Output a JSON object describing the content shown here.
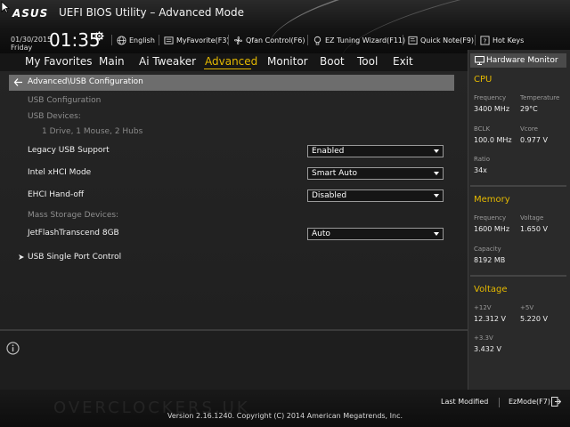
{
  "header": {
    "logo": "ASUS",
    "app_title": "UEFI BIOS Utility – Advanced Mode",
    "date": "01/30/2015",
    "day": "Friday",
    "time": "01:35",
    "buttons": {
      "language": "English",
      "myfavorite": "MyFavorite(F3)",
      "qfan": "Qfan Control(F6)",
      "ez_tuning": "EZ Tuning Wizard(F11)",
      "quick_note": "Quick Note(F9)",
      "hot_keys": "Hot Keys"
    }
  },
  "menu": {
    "tabs": [
      "My Favorites",
      "Main",
      "Ai Tweaker",
      "Advanced",
      "Monitor",
      "Boot",
      "Tool",
      "Exit"
    ],
    "active": "Advanced"
  },
  "main": {
    "breadcrumb": "Advanced\\USB Configuration",
    "section_title": "USB Configuration",
    "usb_devices_label": "USB Devices:",
    "usb_devices_value": "1 Drive, 1 Mouse, 2 Hubs",
    "settings": {
      "legacy_usb": {
        "label": "Legacy USB Support",
        "value": "Enabled"
      },
      "xhci_mode": {
        "label": "Intel xHCI Mode",
        "value": "Smart Auto"
      },
      "ehci_handoff": {
        "label": "EHCI Hand-off",
        "value": "Disabled"
      },
      "jetflash": {
        "label": "JetFlashTranscend 8GB",
        "value": "Auto"
      }
    },
    "mass_storage_label": "Mass Storage Devices:",
    "submenu": "USB Single Port Control"
  },
  "hardware_monitor": {
    "title": "Hardware Monitor",
    "cpu": {
      "title": "CPU",
      "frequency_label": "Frequency",
      "frequency": "3400 MHz",
      "temperature_label": "Temperature",
      "temperature": "29°C",
      "bclk_label": "BCLK",
      "bclk": "100.0 MHz",
      "vcore_label": "Vcore",
      "vcore": "0.977 V",
      "ratio_label": "Ratio",
      "ratio": "34x"
    },
    "memory": {
      "title": "Memory",
      "frequency_label": "Frequency",
      "frequency": "1600 MHz",
      "voltage_label": "Voltage",
      "voltage": "1.650 V",
      "capacity_label": "Capacity",
      "capacity": "8192 MB"
    },
    "voltage": {
      "title": "Voltage",
      "v12_label": "+12V",
      "v12": "12.312 V",
      "v5_label": "+5V",
      "v5": "5.220 V",
      "v33_label": "+3.3V",
      "v33": "3.432 V"
    }
  },
  "footer": {
    "watermark": "OVERCLOCKERS.UK",
    "last_modified": "Last Modified",
    "ezmode": "EzMode(F7)",
    "version": "Version 2.16.1240. Copyright (C) 2014 American Megatrends, Inc."
  },
  "colors": {
    "accent": "#e5b900",
    "background": "#1c1c1c",
    "breadcrumb_bar": "#6d6d6d",
    "panel": "#2a2a2a"
  },
  "icons": [
    "pointer-icon",
    "gear-icon",
    "globe-icon",
    "favorite-icon",
    "fan-icon",
    "bulb-icon",
    "note-icon",
    "help-icon",
    "back-arrow-icon",
    "caret-down-icon",
    "chevron-right-icon",
    "info-icon",
    "monitor-icon",
    "exit-arrow-icon"
  ]
}
